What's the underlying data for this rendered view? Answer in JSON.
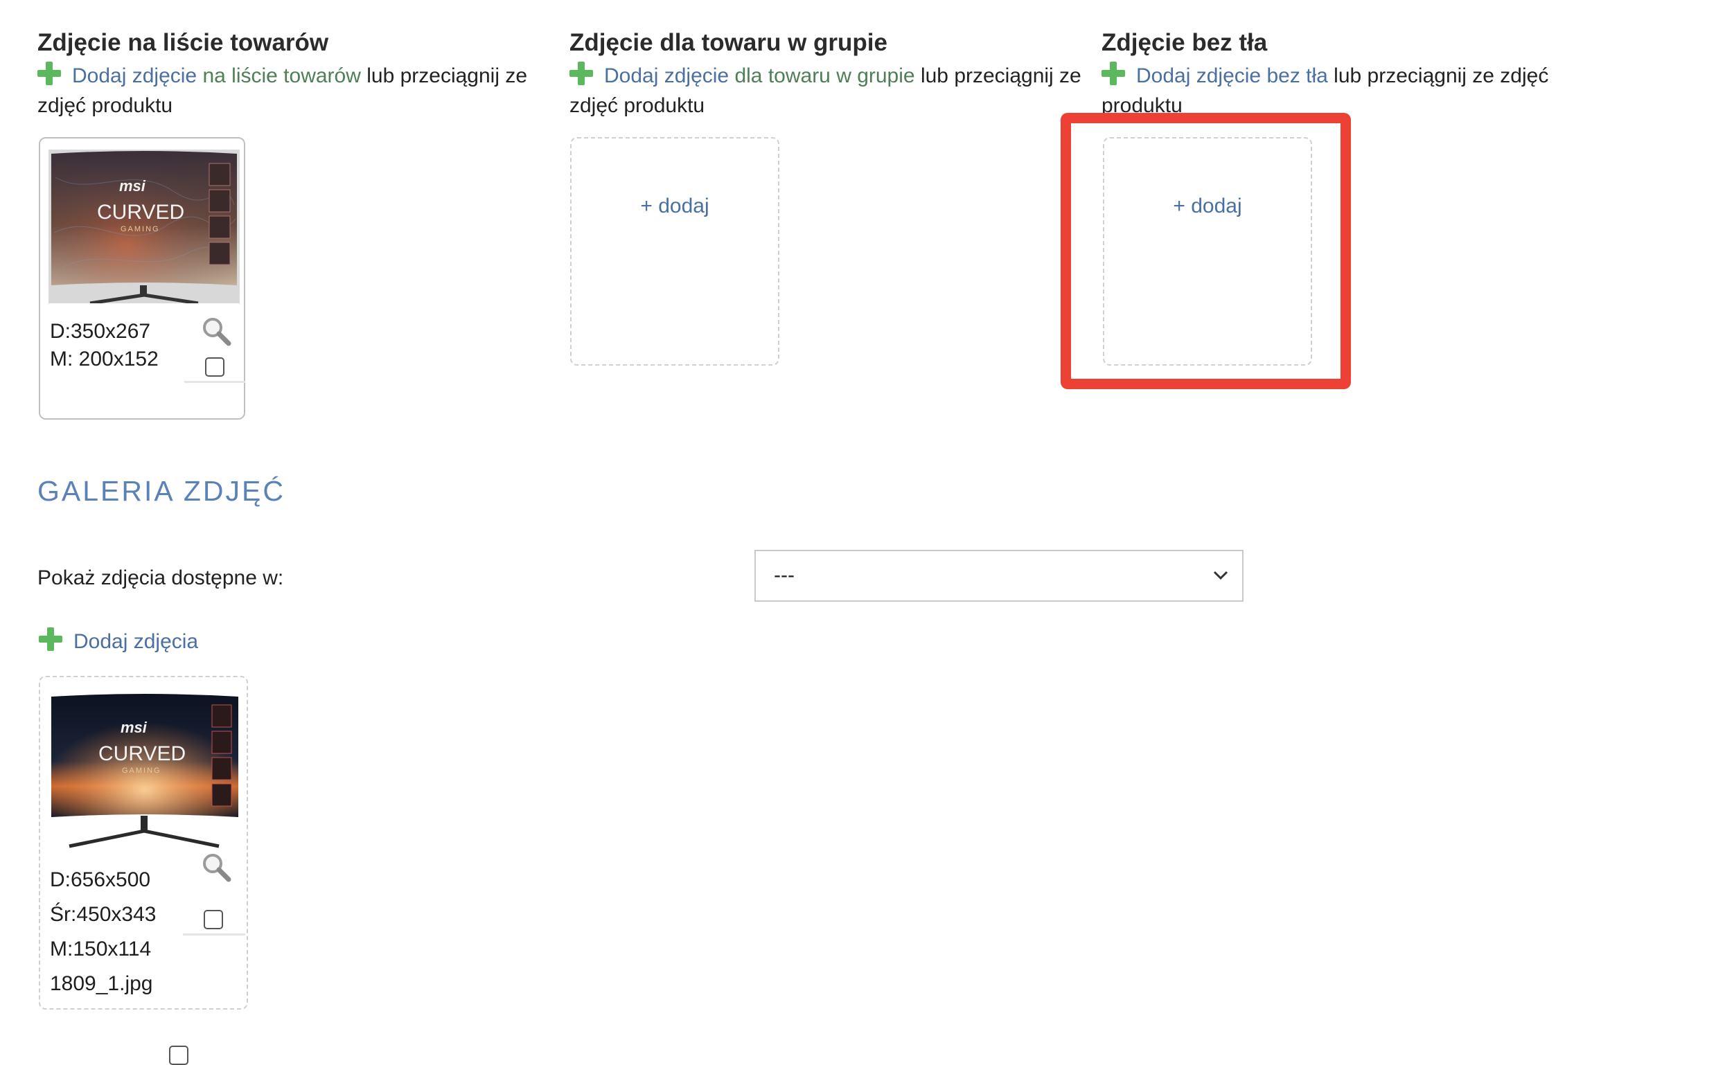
{
  "sections": {
    "list_photo": {
      "title": "Zdjęcie na liście towarów",
      "add_link": "Dodaj zdjęcie",
      "target_link": "na liście towarów",
      "rest": " lub przeciągnij ze zdjęć produktu"
    },
    "group_photo": {
      "title": "Zdjęcie dla towaru w grupie",
      "add_link": "Dodaj zdjęcie",
      "target_link": "dla towaru w grupie",
      "rest": " lub przeciągnij ze zdjęć produktu",
      "dropzone_label": "+ dodaj"
    },
    "no_bg_photo": {
      "title": "Zdjęcie bez tła",
      "add_link": "Dodaj zdjęcie",
      "target_link": "bez tła",
      "rest": " lub przeciągnij ze zdjęć produktu",
      "dropzone_label": "+ dodaj"
    }
  },
  "list_thumb": {
    "image_label": "msi CURVED GAMING monitor",
    "brand_text": "msi",
    "headline_text": "CURVED",
    "sub_text": "GAMING",
    "d_size": "D:350x267",
    "m_size": "M: 200x152",
    "checked": false
  },
  "gallery": {
    "heading": "GALERIA ZDJĘĆ",
    "filter_label": "Pokaż zdjęcia dostępne w:",
    "filter_selected": "---",
    "add_photos": "Dodaj zdjęcia",
    "items": [
      {
        "image_label": "msi CURVED GAMING monitor",
        "brand_text": "msi",
        "headline_text": "CURVED",
        "sub_text": "GAMING",
        "d_size": "D:656x500",
        "sr_size": "Śr:450x343",
        "m_size": "M:150x114",
        "filename": "1809_1.jpg",
        "checked": false
      }
    ]
  },
  "icons": {
    "add": "plus-icon",
    "zoom": "magnifier-icon",
    "dropdown": "chevron-down-icon"
  },
  "colors": {
    "link_blue": "#4a6fa5",
    "link_green": "#4f7f57",
    "plus_green": "#5cb85c",
    "heading_blue": "#5a82b8",
    "highlight_red": "#ee4136"
  }
}
